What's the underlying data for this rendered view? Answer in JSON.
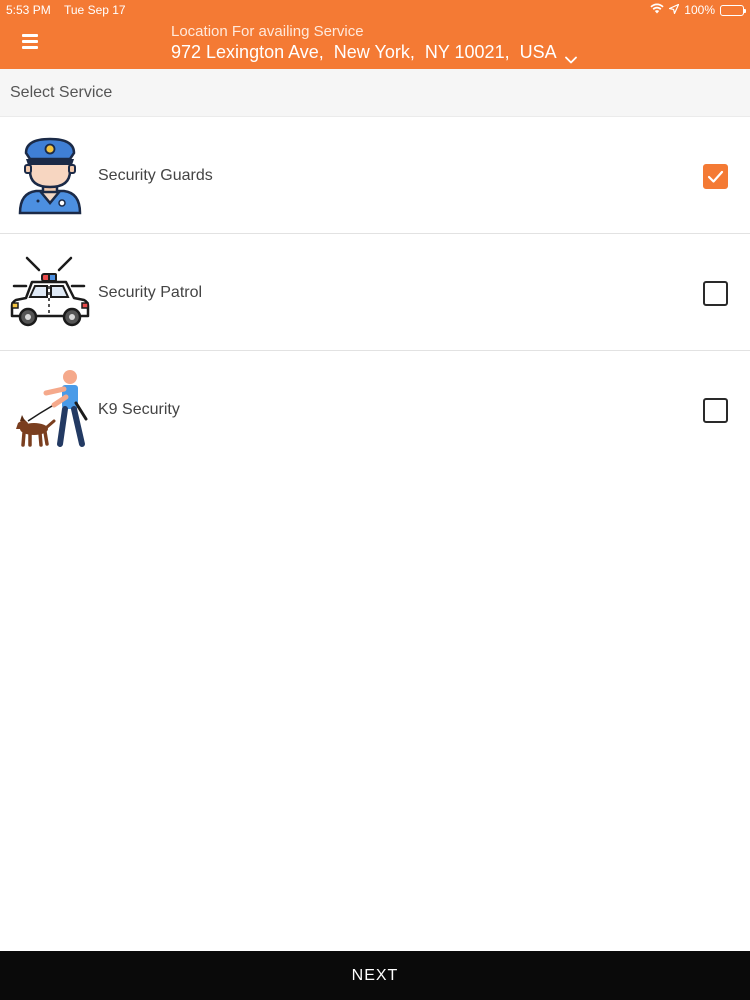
{
  "status_bar": {
    "time": "5:53 PM",
    "date": "Tue Sep 17",
    "battery": "100%",
    "icons": [
      "wifi-icon",
      "location-arrow-icon",
      "battery-icon"
    ]
  },
  "header": {
    "menu_icon": "hamburger-menu-icon",
    "location_label": "Location For availing Service",
    "location_value": "972 Lexington Ave,  New York,  NY 10021,  USA",
    "chevron_icon": "chevron-down-icon",
    "background_color": "#f47a34"
  },
  "section": {
    "title": "Select Service"
  },
  "services": [
    {
      "label": "Security Guards",
      "icon": "security-guard-icon",
      "checked": true
    },
    {
      "label": "Security Patrol",
      "icon": "police-car-icon",
      "checked": false
    },
    {
      "label": "K9 Security",
      "icon": "k9-dog-handler-icon",
      "checked": false
    }
  ],
  "footer": {
    "next_label": "NEXT"
  },
  "colors": {
    "accent": "#f47a34",
    "footer": "#0a0a0a"
  }
}
